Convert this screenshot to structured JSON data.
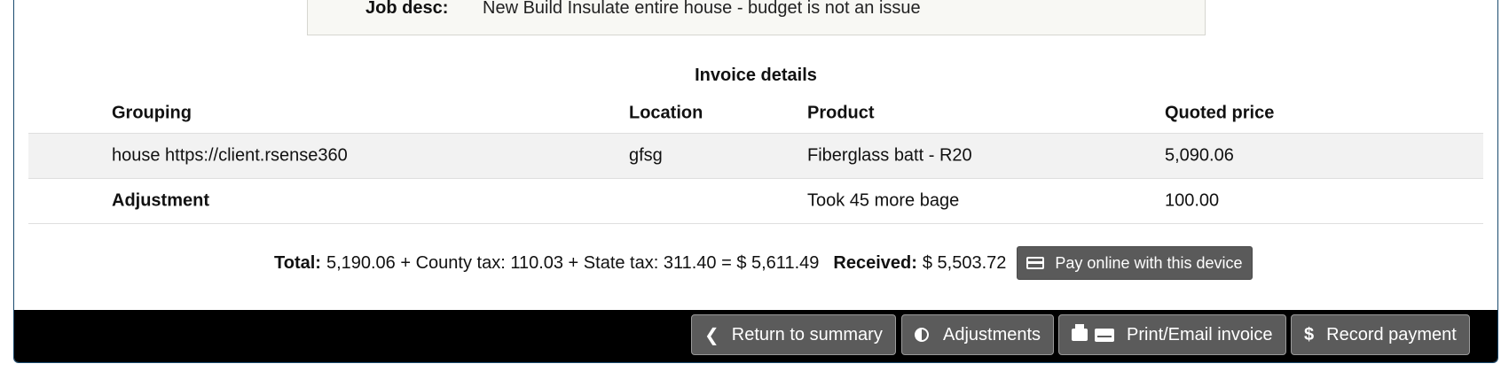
{
  "job": {
    "label": "Job desc:",
    "value": "New Build Insulate entire house - budget is not an issue"
  },
  "invoice": {
    "title": "Invoice details",
    "columns": [
      "Grouping",
      "Location",
      "Product",
      "Quoted price"
    ],
    "rows": [
      {
        "grouping": "house https://client.rsense360",
        "location": "gfsg",
        "product": "Fiberglass batt - R20",
        "price": "5,090.06"
      },
      {
        "grouping": "Adjustment",
        "location": "",
        "product": "Took 45 more bage",
        "price": "100.00"
      }
    ]
  },
  "totals": {
    "total_label": "Total:",
    "total_value": "5,190.06 + County tax: 110.03 + State tax: 311.40 = $ 5,611.49",
    "received_label": "Received:",
    "received_value": "$ 5,503.72",
    "pay_button": "Pay online with this device"
  },
  "toolbar": {
    "return_label": "Return to summary",
    "adjustments_label": "Adjustments",
    "print_label": "Print/Email invoice",
    "record_label": "Record payment"
  },
  "icons": {
    "pay": "credit-card-icon",
    "return": "chevron-left-icon",
    "adjustments": "adjust-icon",
    "print": "print-icon",
    "email": "envelope-icon",
    "record": "dollar-icon"
  }
}
